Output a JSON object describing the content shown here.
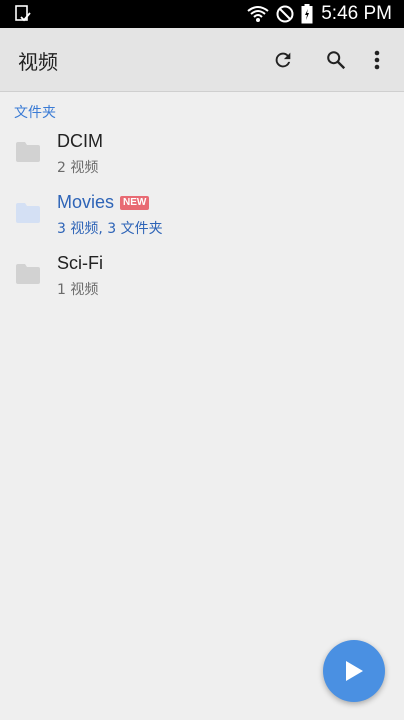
{
  "status_bar": {
    "time": "5:46 PM"
  },
  "app_bar": {
    "title": "视频"
  },
  "section": {
    "header": "文件夹"
  },
  "folders": [
    {
      "name": "DCIM",
      "meta": "2 视频",
      "badge": ""
    },
    {
      "name": "Movies",
      "meta": "3 视频, 3 文件夹",
      "badge": "NEW"
    },
    {
      "name": "Sci-Fi",
      "meta": "1 视频",
      "badge": ""
    }
  ],
  "colors": {
    "accent": "#3a7bd5",
    "badge": "#e86a73",
    "fab": "#4a90e2"
  },
  "icons": {
    "status_left": "device-check-icon",
    "wifi": "wifi-icon",
    "dnd": "do-not-disturb-icon",
    "battery": "battery-icon",
    "refresh": "refresh-icon",
    "search": "search-icon",
    "more": "more-vert-icon",
    "folder": "folder-icon",
    "play": "play-icon"
  }
}
